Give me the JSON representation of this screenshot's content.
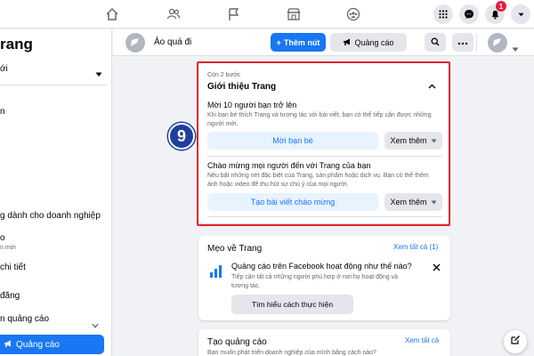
{
  "topnav": {
    "icons": [
      "home-icon",
      "friends-icon",
      "flag-icon",
      "marketplace-icon",
      "groups-icon"
    ],
    "right_icons": [
      "menu-grid-icon",
      "messenger-icon",
      "bell-icon",
      "chevron-down-icon"
    ],
    "notification_count": "1"
  },
  "sidebar": {
    "title": "rang",
    "items": [
      {
        "label": "ới"
      },
      {
        "label": "n"
      },
      {
        "label": "g dành cho doanh nghiệp"
      },
      {
        "label": "o",
        "sub": "n mới"
      },
      {
        "label": "chi tiết"
      },
      {
        "label": "đăng"
      },
      {
        "label": "n quảng cáo"
      }
    ],
    "ads_button": "Quảng cáo"
  },
  "page_header": {
    "page_name": "Ảo quá đi",
    "add_button": "Thêm nút",
    "promote_button": "Quảng cáo"
  },
  "intro_card": {
    "steps_remaining": "Còn 2 bước",
    "title": "Giới thiệu Trang",
    "step1": {
      "title": "Mời 10 người bạn trở lên",
      "description": "Khi bạn bè thích Trang và tương tác với bài viết, bạn có thể tiếp cận được những người mới.",
      "button": "Mời bạn bè",
      "more": "Xem thêm"
    },
    "step2": {
      "title": "Chào mừng mọi người đến với Trang của bạn",
      "description": "Nêu bật những nét đặc biệt của Trang, sản phẩm hoặc dịch vụ. Bạn có thể thêm ảnh hoặc video để thu hút sự chú ý của mọi người.",
      "button": "Tạo bài viết chào mừng",
      "more": "Xem thêm"
    }
  },
  "step_badge": "9",
  "tips_card": {
    "title": "Mẹo về Trang",
    "see_all": "Xem tất cả (1)",
    "tip_title": "Quảng cáo trên Facebook hoạt động như thế nào?",
    "tip_desc": "Tiếp cận tất cả những người phù hợp ở nơi họ hoạt động và tương tác.",
    "tip_button": "Tìm hiểu cách thực hiện"
  },
  "ads_card": {
    "title": "Tạo quảng cáo",
    "see_all": "Xem tất cả",
    "desc": "Bạn muốn phát triển doanh nghiệp của mình bằng cách nào?"
  },
  "colors": {
    "accent": "#1877f2",
    "highlight": "#e0262c",
    "badge": "#1f3f9e"
  }
}
